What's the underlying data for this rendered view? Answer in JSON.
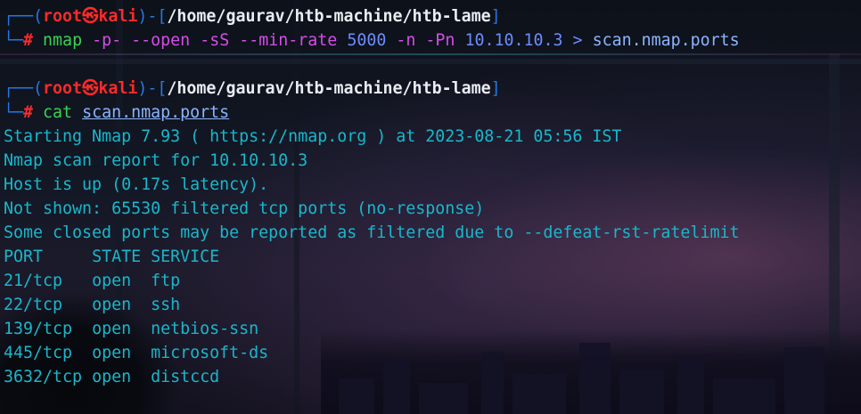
{
  "colors": {
    "accent_cyan": "#19b7cb",
    "prompt_blue": "#2477e6",
    "user_red": "#ff2a2a",
    "command_green": "#39d353",
    "flag_magenta": "#d64de8"
  },
  "prompt": {
    "open": "┌──(",
    "user": "root",
    "at_icon": "㉿",
    "host": "kali",
    "close_dash": ")-[",
    "path": "/home/gaurav/htb-machine/htb-lame",
    "close_bracket": "]",
    "corner": "└─",
    "hash": "#"
  },
  "commands": [
    {
      "program": "nmap",
      "args": [
        {
          "text": "-p-",
          "kind": "flag"
        },
        {
          "text": "--open",
          "kind": "flag"
        },
        {
          "text": "-sS",
          "kind": "flag"
        },
        {
          "text": "--min-rate",
          "kind": "flag"
        },
        {
          "text": "5000",
          "kind": "plain"
        },
        {
          "text": "-n",
          "kind": "flag"
        },
        {
          "text": "-Pn",
          "kind": "flag"
        },
        {
          "text": "10.10.10.3",
          "kind": "plain"
        },
        {
          "text": ">",
          "kind": "plain"
        },
        {
          "text": "scan.nmap.ports",
          "kind": "file"
        }
      ]
    },
    {
      "program": "cat",
      "args": [
        {
          "text": "scan.nmap.ports",
          "kind": "file"
        }
      ]
    }
  ],
  "output": [
    "Starting Nmap 7.93 ( https://nmap.org ) at 2023-08-21 05:56 IST",
    "Nmap scan report for 10.10.10.3",
    "Host is up (0.17s latency).",
    "Not shown: 65530 filtered tcp ports (no-response)",
    "Some closed ports may be reported as filtered due to --defeat-rst-ratelimit"
  ],
  "ports_table": {
    "headers": [
      "PORT",
      "STATE",
      "SERVICE"
    ],
    "rows": [
      [
        "21/tcp",
        "open",
        "ftp"
      ],
      [
        "22/tcp",
        "open",
        "ssh"
      ],
      [
        "139/tcp",
        "open",
        "netbios-ssn"
      ],
      [
        "445/tcp",
        "open",
        "microsoft-ds"
      ],
      [
        "3632/tcp",
        "open",
        "distccd"
      ]
    ]
  }
}
